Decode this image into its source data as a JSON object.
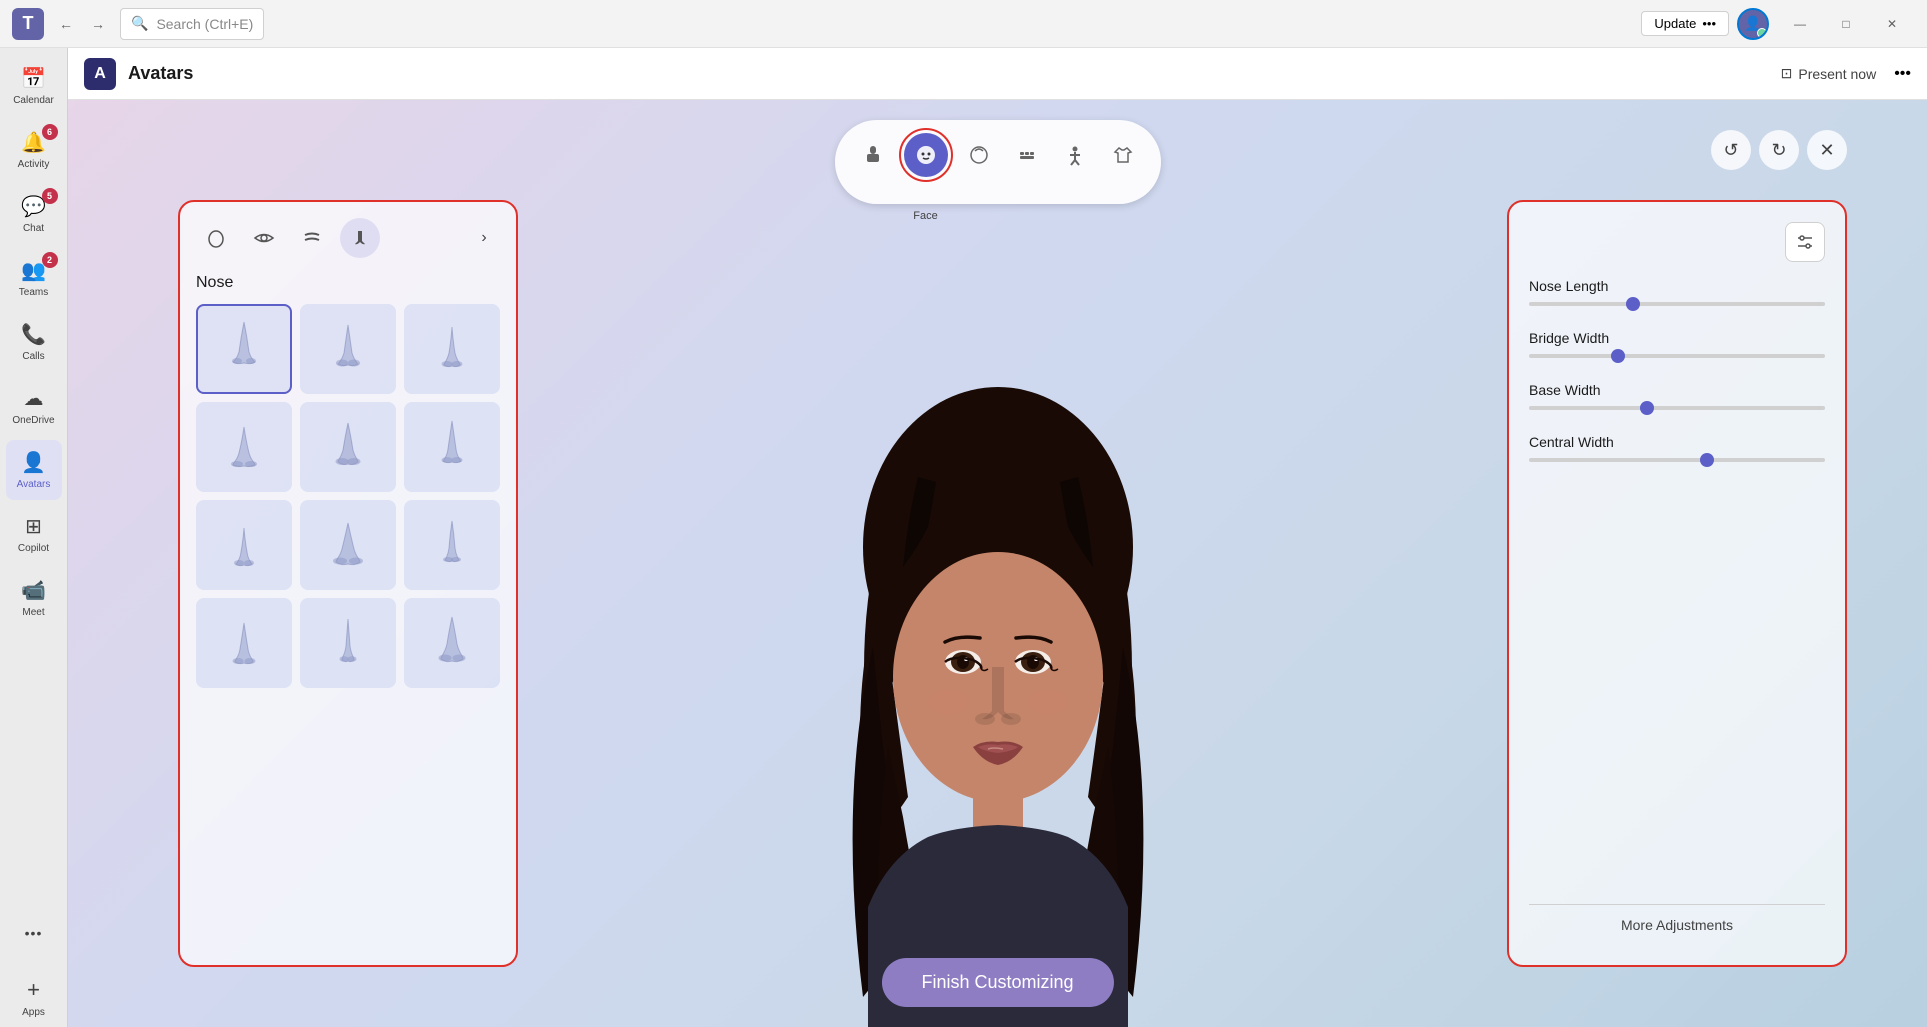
{
  "titleBar": {
    "searchPlaceholder": "Search (Ctrl+E)",
    "updateLabel": "Update",
    "updateMenuIcon": "•••",
    "minimizeLabel": "—",
    "maximizeLabel": "□",
    "closeLabel": "✕"
  },
  "sidebar": {
    "items": [
      {
        "id": "calendar",
        "label": "Calendar",
        "icon": "📅",
        "badge": null,
        "active": false
      },
      {
        "id": "activity",
        "label": "Activity",
        "icon": "🔔",
        "badge": "6",
        "active": false
      },
      {
        "id": "chat",
        "label": "Chat",
        "icon": "💬",
        "badge": "5",
        "active": false
      },
      {
        "id": "teams",
        "label": "Teams",
        "icon": "👥",
        "badge": "2",
        "active": false
      },
      {
        "id": "calls",
        "label": "Calls",
        "icon": "📞",
        "badge": null,
        "active": false
      },
      {
        "id": "onedrive",
        "label": "OneDrive",
        "icon": "☁",
        "badge": null,
        "active": false
      },
      {
        "id": "avatars",
        "label": "Avatars",
        "icon": "👤",
        "badge": null,
        "active": true
      },
      {
        "id": "copilot",
        "label": "Copilot",
        "icon": "⊞",
        "badge": null,
        "active": false
      },
      {
        "id": "meet",
        "label": "Meet",
        "icon": "📹",
        "badge": null,
        "active": false
      },
      {
        "id": "more",
        "label": "•••",
        "icon": "•••",
        "badge": null,
        "active": false
      },
      {
        "id": "apps",
        "label": "Apps",
        "icon": "+",
        "badge": null,
        "active": false
      }
    ]
  },
  "appHeader": {
    "iconLabel": "A",
    "title": "Avatars",
    "presentNowLabel": "Present now",
    "moreOptionsLabel": "•••"
  },
  "categoryToolbar": {
    "categories": [
      {
        "id": "body",
        "icon": "🖼",
        "label": "",
        "active": false
      },
      {
        "id": "face",
        "icon": "😐",
        "label": "Face",
        "active": true
      },
      {
        "id": "hair-face",
        "icon": "🌀",
        "label": "",
        "active": false
      },
      {
        "id": "facial-hair",
        "icon": "⬛",
        "label": "",
        "active": false
      },
      {
        "id": "body-shape",
        "icon": "🧍",
        "label": "",
        "active": false
      },
      {
        "id": "clothing",
        "icon": "👕",
        "label": "",
        "active": false
      }
    ]
  },
  "editControls": {
    "undoLabel": "↺",
    "redoLabel": "↻",
    "closeLabel": "✕"
  },
  "leftPanel": {
    "subTabs": [
      {
        "id": "face-shape",
        "icon": "😐",
        "active": false
      },
      {
        "id": "eyes",
        "icon": "👁",
        "active": false
      },
      {
        "id": "eyebrows",
        "icon": "〰",
        "active": false
      },
      {
        "id": "nose",
        "icon": "⌒",
        "active": true
      }
    ],
    "nextLabel": "›",
    "sectionTitle": "Nose",
    "noseOptions": [
      {
        "id": 1,
        "selected": false
      },
      {
        "id": 2,
        "selected": false
      },
      {
        "id": 3,
        "selected": false
      },
      {
        "id": 4,
        "selected": false
      },
      {
        "id": 5,
        "selected": false
      },
      {
        "id": 6,
        "selected": false
      },
      {
        "id": 7,
        "selected": false
      },
      {
        "id": 8,
        "selected": false
      },
      {
        "id": 9,
        "selected": false
      },
      {
        "id": 10,
        "selected": false
      },
      {
        "id": 11,
        "selected": false
      },
      {
        "id": 12,
        "selected": false
      }
    ]
  },
  "rightPanel": {
    "settingsIcon": "⚙",
    "sliders": [
      {
        "id": "nose-length",
        "label": "Nose Length",
        "value": 35,
        "max": 100
      },
      {
        "id": "bridge-width",
        "label": "Bridge Width",
        "value": 30,
        "max": 100
      },
      {
        "id": "base-width",
        "label": "Base Width",
        "value": 40,
        "max": 100
      },
      {
        "id": "central-width",
        "label": "Central Width",
        "value": 60,
        "max": 100
      }
    ],
    "moreAdjustmentsLabel": "More Adjustments"
  },
  "finishBtn": {
    "label": "Finish Customizing"
  }
}
